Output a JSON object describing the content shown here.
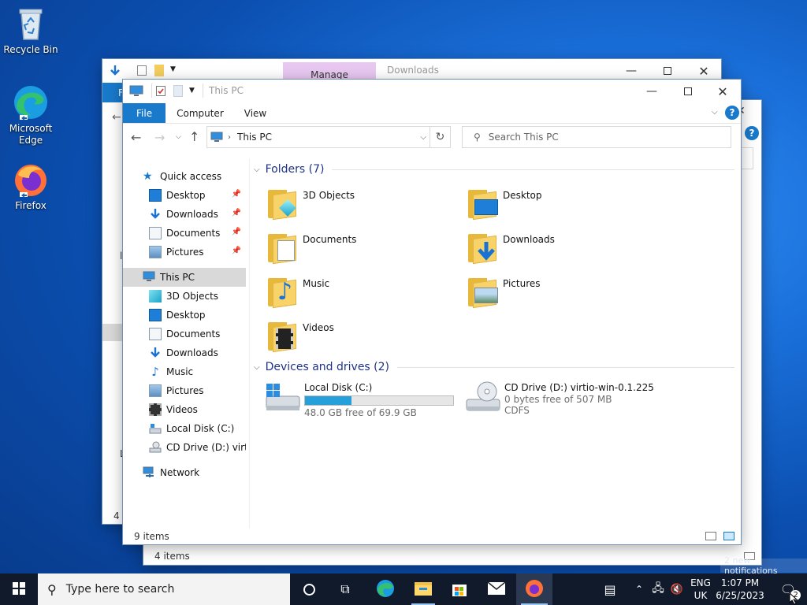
{
  "desktop_icons": [
    {
      "label": "Recycle Bin"
    },
    {
      "label": "Microsoft Edge"
    },
    {
      "label": "Firefox"
    }
  ],
  "back_window": {
    "manage_tab": "Manage",
    "title": "Downloads",
    "ribbon_file": "F",
    "status_items": "4 items",
    "left_status": "4 i",
    "partial_letters": [
      "l",
      "L"
    ]
  },
  "window": {
    "title": "This PC",
    "ribbon_tabs": [
      "File",
      "Computer",
      "View"
    ],
    "address": "This PC",
    "search_placeholder": "Search This PC",
    "nav": {
      "quick_access": "Quick access",
      "quick_items": [
        {
          "label": "Desktop"
        },
        {
          "label": "Downloads"
        },
        {
          "label": "Documents"
        },
        {
          "label": "Pictures"
        }
      ],
      "this_pc": "This PC",
      "pc_items": [
        {
          "label": "3D Objects"
        },
        {
          "label": "Desktop"
        },
        {
          "label": "Documents"
        },
        {
          "label": "Downloads"
        },
        {
          "label": "Music"
        },
        {
          "label": "Pictures"
        },
        {
          "label": "Videos"
        },
        {
          "label": "Local Disk (C:)"
        },
        {
          "label": "CD Drive (D:) virtio-"
        }
      ],
      "network": "Network"
    },
    "folders_header": "Folders (7)",
    "folders": [
      {
        "name": "3D Objects"
      },
      {
        "name": "Desktop"
      },
      {
        "name": "Documents"
      },
      {
        "name": "Downloads"
      },
      {
        "name": "Music"
      },
      {
        "name": "Pictures"
      },
      {
        "name": "Videos"
      }
    ],
    "drives_header": "Devices and drives (2)",
    "drives": [
      {
        "name": "Local Disk (C:)",
        "free": "48.0 GB free of 69.9 GB",
        "used_fraction": 0.313
      },
      {
        "name": "CD Drive (D:) virtio-win-0.1.225",
        "free": "0 bytes free of 507 MB",
        "fs": "CDFS"
      }
    ],
    "status": "9 items"
  },
  "taskbar": {
    "search_placeholder": "Type here to search",
    "lang_top": "ENG",
    "lang_bottom": "UK",
    "time": "1:07 PM",
    "date": "6/25/2023",
    "notif_count": "2",
    "notif_toast": "2 new notifications"
  },
  "colors": {
    "accent": "#1979ca",
    "selection": "#cce8ff",
    "header_text": "#1e3287",
    "progress": "#26a0da"
  }
}
